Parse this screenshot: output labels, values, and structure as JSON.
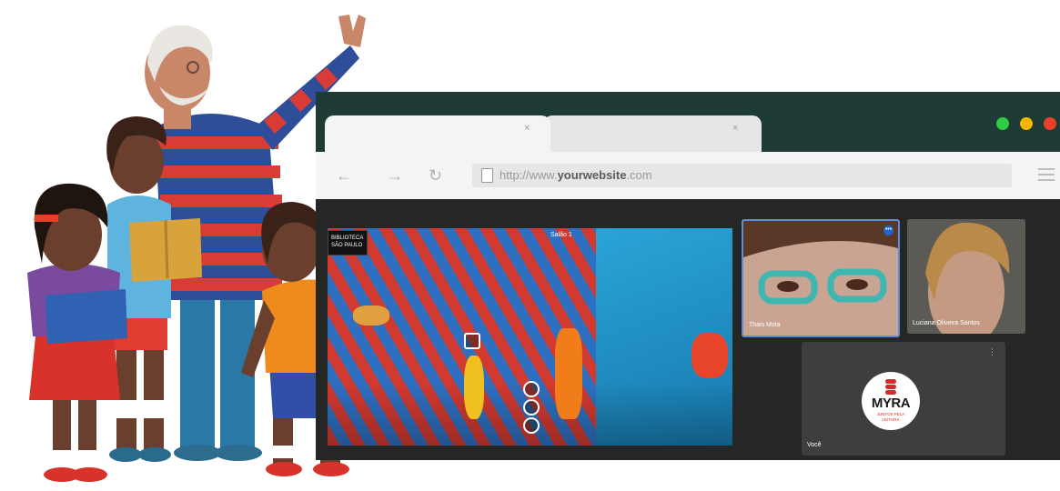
{
  "browser": {
    "tabs": [
      {
        "close": "×"
      },
      {
        "close": "×"
      }
    ],
    "window_controls": {
      "colors": [
        "#2ecc40",
        "#f5b800",
        "#e8402a"
      ]
    },
    "nav": {
      "back_icon": "arrow-left-icon",
      "forward_icon": "arrow-right-icon",
      "reload_icon": "reload-icon"
    },
    "url": {
      "prefix": "http://www.",
      "domain": "yourwebsite",
      "suffix": ".com"
    }
  },
  "meeting": {
    "shared_screen": {
      "badge": "BIBLIOTECA\nSÃO PAULO",
      "location_tag": "Salão 1"
    },
    "participants": [
      {
        "name": "Thais Mota",
        "has_menu": true
      },
      {
        "name": "Luciana Oliveira Santos"
      },
      {
        "name": "Você",
        "avatar_logo": {
          "name": "MYRA",
          "tagline": "JUNTOS PELA\nLEITURA"
        }
      }
    ]
  },
  "colors": {
    "tabbar": "#1e3b35",
    "accent_blue": "#1e66d0",
    "brand_red": "#d52a2a"
  }
}
